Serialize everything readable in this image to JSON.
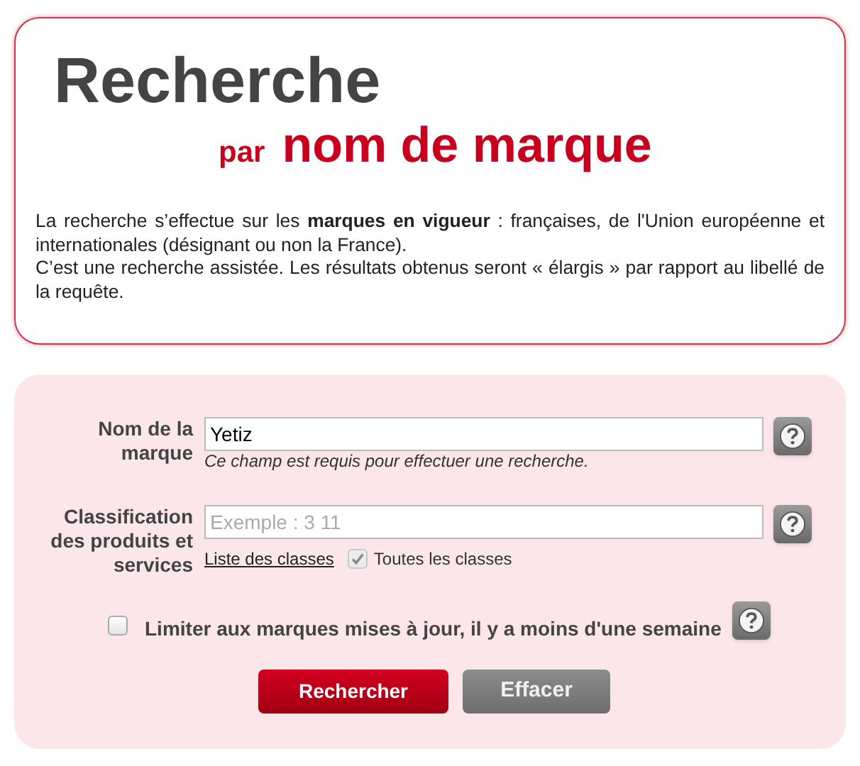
{
  "header": {
    "title": "Recherche",
    "subtitle_prefix": "par",
    "subtitle": "nom de marque",
    "description": [
      "La recherche s’effectue sur les **marques en vigueur** : françaises, de l'Union européenne et internationales (désignant ou non la France).",
      "C’est une recherche assistée. Les résultats obtenus seront « élargis » par rapport au libellé de la requête."
    ]
  },
  "form": {
    "fields": [
      {
        "label": "Nom de la marque",
        "value": "Yetiz",
        "hint": "Ce champ est requis pour effectuer une recherche."
      },
      {
        "label": "Classification des produits et services",
        "placeholder": "Exemple : 3 11",
        "link": "Liste des classes",
        "option": {
          "label": "Toutes les classes",
          "checked": true
        }
      }
    ],
    "limit": {
      "label": "Limiter aux marques mises à jour, il y a moins d'une semaine",
      "checked": false
    },
    "buttons": [
      {
        "label": "Rechercher",
        "kind": "primary"
      },
      {
        "label": "Effacer",
        "kind": "secondary"
      }
    ]
  }
}
